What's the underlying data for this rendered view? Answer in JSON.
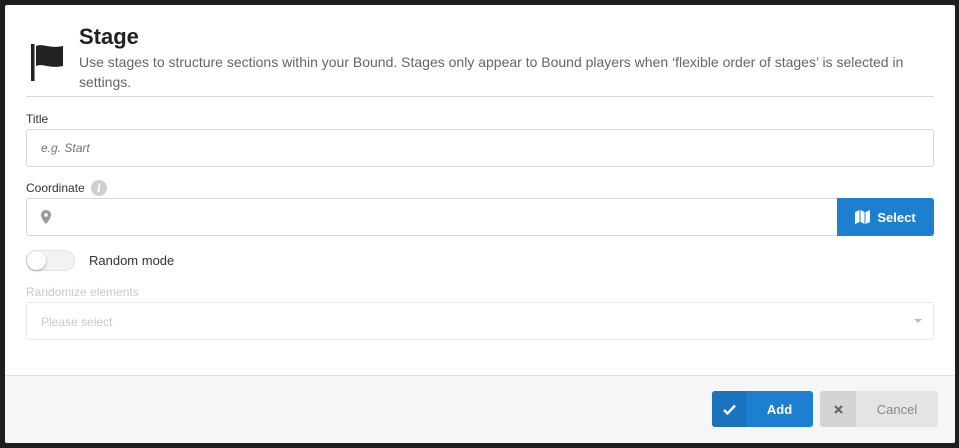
{
  "header": {
    "title": "Stage",
    "description": "Use stages to structure sections within your Bound. Stages only appear to Bound players when ‘flexible order of stages’ is selected in settings."
  },
  "form": {
    "title_label": "Title",
    "title_placeholder": "e.g. Start",
    "title_value": "",
    "coordinate_label": "Coordinate",
    "coordinate_value": "",
    "select_button": "Select",
    "random_mode_label": "Random mode",
    "random_mode_on": false,
    "randomize_label": "Randomize elements",
    "randomize_placeholder": "Please select"
  },
  "footer": {
    "add_label": "Add",
    "cancel_label": "Cancel"
  },
  "colors": {
    "primary": "#1d7fd0",
    "cancel_bg": "#e4e4e4",
    "muted_text": "#c9c9c9"
  },
  "icons": [
    "flag-icon",
    "info-icon",
    "map-pin-icon",
    "map-icon",
    "checkmark-icon",
    "close-icon",
    "chevron-down-icon"
  ]
}
